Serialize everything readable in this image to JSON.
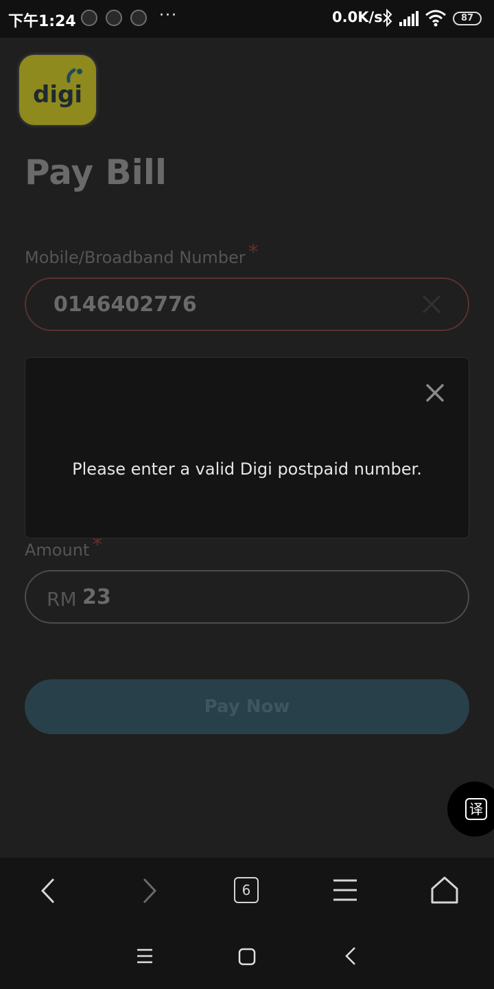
{
  "status_bar": {
    "time": "下午1:24",
    "app_icons": [
      "mobile-app-icon",
      "tiktok-icon",
      "browser-app-icon"
    ],
    "more": "···",
    "net_speed": "0.0K/s",
    "battery": "87",
    "icons": [
      "bluetooth-icon",
      "signal-icon",
      "wifi-icon",
      "battery-icon"
    ]
  },
  "page": {
    "logo_text": "digi",
    "title": "Pay Bill",
    "number_label": "Mobile/Broadband Number",
    "required_mark": "*",
    "number_value": "0146402776",
    "amount_label": "Amount",
    "currency": "RM",
    "amount_value": "23",
    "pay_button": "Pay Now"
  },
  "modal": {
    "message": "Please enter a valid Digi postpaid number."
  },
  "translate_button": "译",
  "browser_toolbar": {
    "tab_count": "6",
    "icons": [
      "back-icon",
      "forward-icon",
      "tabs-icon",
      "menu-icon",
      "home-icon"
    ]
  },
  "colors": {
    "background": "#1f1f1f",
    "modal_bg": "#141414",
    "pay_button": "#28404a",
    "logo_bg": "#8f8a1e"
  }
}
